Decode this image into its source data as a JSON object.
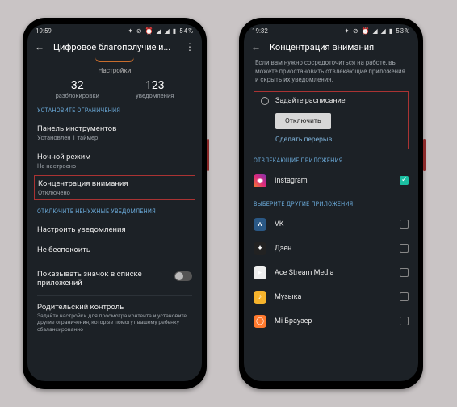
{
  "phone1": {
    "time": "19:59",
    "status_icons": "✦ ⊘ ⏰ ◢ ◢ ▮ 54%",
    "title": "Цифровое благополучие и...",
    "subtitle": "Настройки",
    "stats": {
      "unlocks_num": "32",
      "unlocks_label": "разблокировки",
      "notif_num": "123",
      "notif_label": "уведомления"
    },
    "sections": {
      "limits_header": "УСТАНОВИТЕ ОГРАНИЧЕНИЯ",
      "disable_notif_header": "ОТКЛЮЧИТЕ НЕНУЖНЫЕ УВЕДОМЛЕНИЯ"
    },
    "rows": {
      "dashboard_title": "Панель инструментов",
      "dashboard_sub": "Установлен 1 таймер",
      "night_title": "Ночной режим",
      "night_sub": "Не настроено",
      "focus_title": "Концентрация внимания",
      "focus_sub": "Отключено",
      "notif_title": "Настроить уведомления",
      "dnd_title": "Не беспокоить",
      "badge_title": "Показывать значок в списке приложений",
      "parental_title": "Родительский контроль",
      "parental_sub": "Задайте настройки для просмотра контента и установите другие ограничения, которые помогут вашему ребенку сбалансированно"
    }
  },
  "phone2": {
    "time": "19:32",
    "status_icons": "✦ ⊘ ⏰ ◢ ◢ ▮ 53%",
    "title": "Концентрация внимания",
    "desc": "Если вам нужно сосредоточиться на работе, вы можете приостановить отвлекающие приложения и скрыть их уведомления.",
    "schedule_label": "Задайте расписание",
    "disable_btn": "Отключить",
    "pause_link": "Сделать перерыв",
    "distracting_header": "ОТВЛЕКАЮЩИЕ ПРИЛОЖЕНИЯ",
    "other_header": "ВЫБЕРИТЕ ДРУГИЕ ПРИЛОЖЕНИЯ",
    "apps": {
      "instagram": "Instagram",
      "vk": "VK",
      "zen": "Дзен",
      "ace": "Ace Stream Media",
      "music": "Музыка",
      "mi": "Mi Браузер"
    }
  }
}
